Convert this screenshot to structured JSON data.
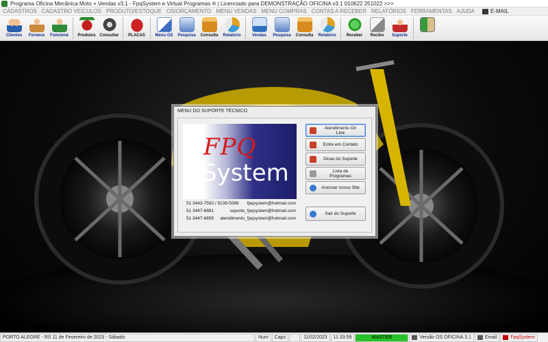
{
  "window": {
    "title": "Programa Oficina Mecânica Moto + Vendas v3.1 - FpqSystem e Virtual Programas ® | Licenciado para  DEMONSTRAÇÃO OFICINA v3.1 010622 251022 >>>"
  },
  "menu": {
    "items": [
      "CADASTROS",
      "CADASTRO VEÍCULOS",
      "PRODUTO/ESTOQUE",
      "OS/ORÇAMENTO",
      "MENU VENDAS",
      "MENU COMPRAS",
      "CONTAS A RECEBER",
      "RELATÓRIOS",
      "FERRAMENTAS",
      "AJUDA"
    ],
    "email": "E-MAIL"
  },
  "toolbar": {
    "buttons": [
      {
        "label": "Clientes",
        "icon": "clients-icon",
        "color": "#2a5fb0"
      },
      {
        "label": "Fornece",
        "icon": "supplier-icon",
        "color": "#c98a3a"
      },
      {
        "label": "Funcioná",
        "icon": "employee-icon",
        "color": "#2f8a3a"
      },
      {
        "label": "Produtos",
        "icon": "products-icon",
        "color": "#c21e1e"
      },
      {
        "label": "Consultar",
        "icon": "tire-icon",
        "color": "#444444"
      },
      {
        "label": "PLACAS",
        "icon": "plate-icon",
        "color": "#cc2222"
      },
      {
        "label": "Menu OS",
        "icon": "os-icon",
        "color": "#3d6ec2"
      },
      {
        "label": "Pesquisa",
        "icon": "os-search-icon",
        "color": "#5f86c9"
      },
      {
        "label": "Consulta",
        "icon": "folder-icon",
        "color": "#d88b1e"
      },
      {
        "label": "Relatório",
        "icon": "report-icon",
        "color": "#e0a020"
      },
      {
        "label": "Vendas",
        "icon": "sales-icon",
        "color": "#2e6fbf"
      },
      {
        "label": "Pesquisa",
        "icon": "sales-search-icon",
        "color": "#5f86c9"
      },
      {
        "label": "Consulta",
        "icon": "sales-folder-icon",
        "color": "#d88b1e"
      },
      {
        "label": "Relatório",
        "icon": "sales-report-icon",
        "color": "#e0a020"
      },
      {
        "label": "Receber",
        "icon": "money-icon",
        "color": "#2aa02a"
      },
      {
        "label": "Recibo",
        "icon": "receipt-icon",
        "color": "#888888"
      },
      {
        "label": "Suporte",
        "icon": "support-icon",
        "color": "#c22a2a"
      },
      {
        "label": "",
        "icon": "exit-icon",
        "color": "#3a9a3a"
      }
    ]
  },
  "dialog": {
    "title": "MENU DO SUPORTE TÉCNICO",
    "logo_line1": "FPQ",
    "logo_line2": "System",
    "contacts": [
      {
        "phone": "51 3443-7592 / 9139-5089",
        "email": "fpqsystem@hotmail.com"
      },
      {
        "phone": "51 3447-6881",
        "email": "suporte_fpqsystem@hotmail.com"
      },
      {
        "phone": "51 3447-6895",
        "email": "atendimento_fpqsystem@hotmail.com"
      }
    ],
    "buttons": [
      {
        "label": "Atendimento On Line",
        "icon": "online-icon",
        "color": "#c8402a"
      },
      {
        "label": "Entre em Contato",
        "icon": "contact-icon",
        "color": "#c8402a"
      },
      {
        "label": "Dicas do Suporte",
        "icon": "tips-icon",
        "color": "#c8402a"
      },
      {
        "label": "Lista de Programas",
        "icon": "list-icon",
        "color": "#9a9a9a"
      },
      {
        "label": "Acessar nosso Site",
        "icon": "globe-icon",
        "color": "#3a7ad0"
      }
    ],
    "exit_button": {
      "label": "Sair do Suporte",
      "icon": "exit-support-icon",
      "color": "#3a7ad0"
    }
  },
  "status": {
    "location_date": "PORTO ALEGRE - RS 11 de Fevereiro de 2023 - Sábado",
    "num": "Num",
    "caps": "Caps",
    "date": "11/02/2023",
    "time": "11:33:59",
    "master": "MASTER",
    "version": "Versão OS OFICINA 3.1",
    "email": "Email",
    "brand": "FpqSystem"
  }
}
